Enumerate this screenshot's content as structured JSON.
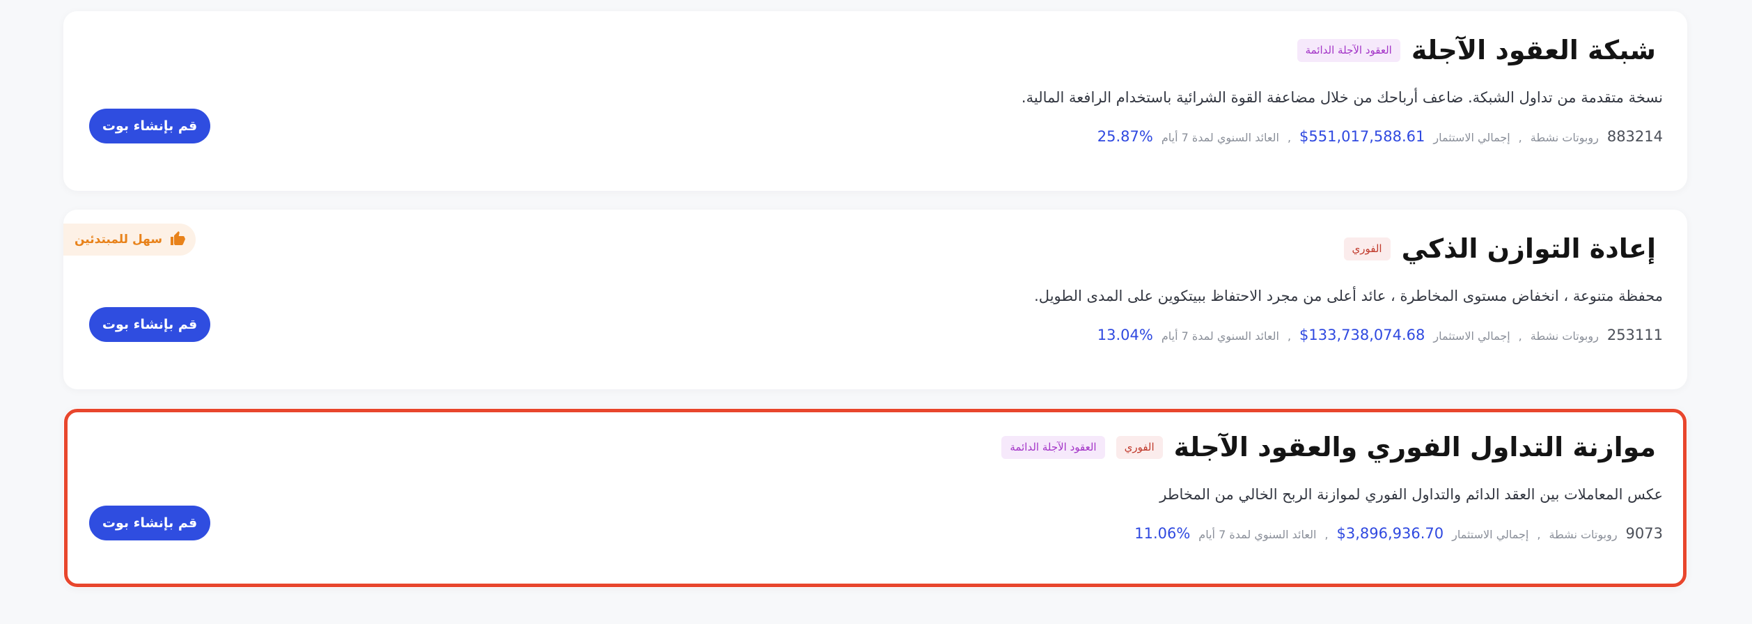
{
  "cards": [
    {
      "title": "شبكة العقود الآجلة",
      "tags": [
        "العقود الآجلة الدائمة"
      ],
      "description": "نسخة متقدمة من تداول الشبكة. ضاعف أرباحك من خلال مضاعفة القوة الشرائية باستخدام الرافعة المالية.",
      "bots_count": "883214",
      "bots_label": "روبوتات نشطة",
      "investment_label": "إجمالي الاستثمار",
      "investment_value": "$551,017,588.61",
      "apy_label": "العائد السنوي لمدة 7 أيام",
      "apy_value": "25.87%",
      "button_label": "قم بإنشاء بوت"
    },
    {
      "title": "إعادة التوازن الذكي",
      "tags": [
        "الفوري"
      ],
      "description": "محفظة متنوعة ، انخفاض مستوى المخاطرة ، عائد أعلى من مجرد الاحتفاظ ببيتكوين على المدى الطويل.",
      "bots_count": "253111",
      "bots_label": "روبوتات نشطة",
      "investment_label": "إجمالي الاستثمار",
      "investment_value": "$133,738,074.68",
      "apy_label": "العائد السنوي لمدة 7 أيام",
      "apy_value": "13.04%",
      "button_label": "قم بإنشاء بوت",
      "badge": "سهل للمبتدئين"
    },
    {
      "title": "موازنة التداول الفوري والعقود الآجلة",
      "tags": [
        "الفوري",
        "العقود الآجلة الدائمة"
      ],
      "description": "عكس المعاملات بين العقد الدائم والتداول الفوري لموازنة الربح الخالي من المخاطر",
      "bots_count": "9073",
      "bots_label": "روبوتات نشطة",
      "investment_label": "إجمالي الاستثمار",
      "investment_value": "$3,896,936.70",
      "apy_label": "العائد السنوي لمدة 7 أيام",
      "apy_value": "11.06%",
      "button_label": "قم بإنشاء بوت",
      "highlighted": true
    }
  ],
  "icons": {
    "badge_icon": "thumbs-up-icon"
  },
  "colors": {
    "button_bg": "#2f4de0",
    "value_text": "#2f49e0",
    "highlight_border": "#e8462d",
    "badge_text": "#e8821a",
    "perp_tag_text": "#a334c7",
    "spot_tag_text": "#c0392b"
  }
}
